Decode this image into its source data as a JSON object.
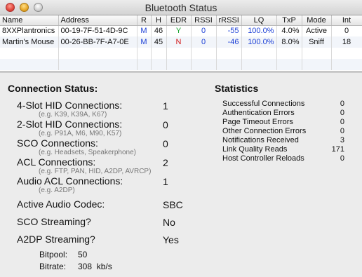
{
  "window": {
    "title": "Bluetooth Status"
  },
  "table": {
    "headers": [
      "Name",
      "Address",
      "R",
      "H",
      "EDR",
      "RSSI",
      "rRSSI",
      "LQ",
      "TxP",
      "Mode",
      "Int"
    ],
    "rows": [
      [
        "8XXPlantronics",
        "00-19-7F-51-4D-9C",
        "M",
        "46",
        "Y",
        "0",
        "-55",
        "100.0%",
        "4.0%",
        "Active",
        "0"
      ],
      [
        "Martin's Mouse",
        "00-26-BB-7F-A7-0E",
        "M",
        "45",
        "N",
        "0",
        "-46",
        "100.0%",
        "8.0%",
        "Sniff",
        "18"
      ]
    ]
  },
  "connection": {
    "heading": "Connection Status:",
    "items": [
      {
        "label": "4-Slot HID Connections:",
        "hint": "(e.g. K39, K39A, K67)",
        "value": "1"
      },
      {
        "label": "2-Slot HID Connections:",
        "hint": "(e.g. P91A, M6, M90, K57)",
        "value": "0"
      },
      {
        "label": "SCO Connections:",
        "hint": "(e.g. Headsets, Speakerphone)",
        "value": "0"
      },
      {
        "label": "ACL Connections:",
        "hint": "(e.g. FTP, PAN, HID, A2DP, AVRCP)",
        "value": "2"
      },
      {
        "label": "Audio ACL Connections:",
        "hint": "(e.g. A2DP)",
        "value": "1"
      },
      {
        "label": "Active Audio Codec:",
        "hint": "",
        "value": "SBC"
      },
      {
        "label": "SCO Streaming?",
        "hint": "",
        "value": "No"
      },
      {
        "label": "A2DP Streaming?",
        "hint": "",
        "value": "Yes"
      }
    ],
    "bitpool_label": "Bitpool:",
    "bitpool_value": "50",
    "bitrate_label": "Bitrate:",
    "bitrate_value": "308  kb/s"
  },
  "statistics": {
    "heading": "Statistics",
    "items": [
      {
        "label": "Successful Connections",
        "value": "0"
      },
      {
        "label": "Authentication Errors",
        "value": "0"
      },
      {
        "label": "Page Timeout Errors",
        "value": "0"
      },
      {
        "label": "Other Connection Errors",
        "value": "0"
      },
      {
        "label": "Notifications Received",
        "value": "3"
      },
      {
        "label": "Link Quality Reads",
        "value": "171"
      },
      {
        "label": "Host Controller Reloads",
        "value": "0"
      }
    ]
  }
}
